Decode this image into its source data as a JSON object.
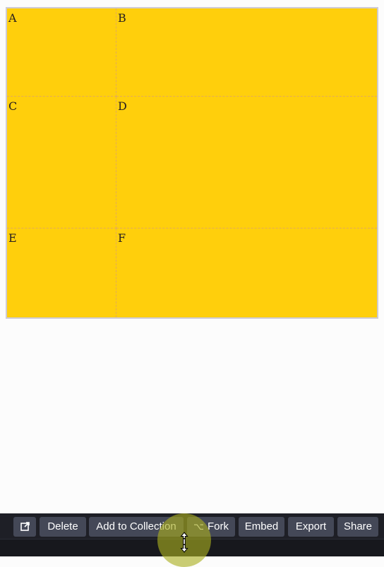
{
  "preview": {
    "cells": [
      {
        "label": "A"
      },
      {
        "label": "B"
      },
      {
        "label": "C"
      },
      {
        "label": "D"
      },
      {
        "label": "E"
      },
      {
        "label": "F"
      }
    ]
  },
  "toolbar": {
    "open_icon": "external-link-icon",
    "delete_label": "Delete",
    "add_to_collection_label": "Add to Collection",
    "fork_glyph": "⌥",
    "fork_label": "Fork",
    "embed_label": "Embed",
    "export_label": "Export",
    "share_label": "Share"
  },
  "colors": {
    "grid_background": "#ffcf0c",
    "grid_border": "#cfcbd3",
    "toolbar_background": "#1e1f26",
    "button_background": "#444857",
    "cursor_highlight": "#aaaf1e"
  },
  "cursor": {
    "icon": "resize-vertical-cursor-icon"
  }
}
